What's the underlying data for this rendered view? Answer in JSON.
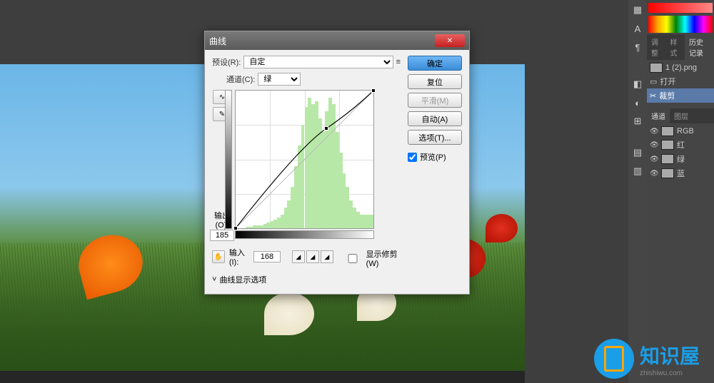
{
  "dialog": {
    "title": "曲线",
    "preset_label": "预设(R):",
    "preset_value": "自定",
    "channel_label": "通道(C):",
    "channel_value": "绿",
    "output_label": "输出(O):",
    "output_value": "185",
    "input_label": "输入(I):",
    "input_value": "168",
    "show_clipping_label": "显示修剪(W)",
    "display_options_label": "曲线显示选项",
    "buttons": {
      "ok": "确定",
      "reset": "复位",
      "smooth": "平滑(M)",
      "auto": "自动(A)",
      "options": "选项(T)...",
      "preview": "预览(P)"
    }
  },
  "panels": {
    "tabs": {
      "adjustments": "调整",
      "styles": "样式",
      "history": "历史记录"
    },
    "history_items": [
      {
        "label": "1 (2).png",
        "icon": "image"
      },
      {
        "label": "打开",
        "icon": "open"
      },
      {
        "label": "裁剪",
        "icon": "crop"
      }
    ],
    "channel_tab": "通道",
    "path_tab": "图层",
    "channels": [
      {
        "label": "RGB"
      },
      {
        "label": "红"
      },
      {
        "label": "绿"
      },
      {
        "label": "蓝"
      }
    ]
  },
  "watermark": {
    "text": "知识屋",
    "sub": "zhishiwu.com"
  },
  "chart_data": {
    "type": "curve",
    "title": "曲线",
    "channel": "绿",
    "xlabel": "输入",
    "ylabel": "输出",
    "xlim": [
      0,
      255
    ],
    "ylim": [
      0,
      255
    ],
    "points": [
      {
        "x": 0,
        "y": 0
      },
      {
        "x": 168,
        "y": 185
      },
      {
        "x": 255,
        "y": 255
      }
    ],
    "histogram_approx": [
      0,
      0,
      0,
      1,
      1,
      2,
      2,
      2,
      3,
      4,
      5,
      6,
      8,
      10,
      15,
      20,
      30,
      45,
      60,
      75,
      88,
      95,
      90,
      92,
      80,
      70,
      85,
      95,
      90,
      70,
      55,
      40,
      30,
      20,
      15,
      12,
      10,
      10,
      10,
      10
    ]
  }
}
